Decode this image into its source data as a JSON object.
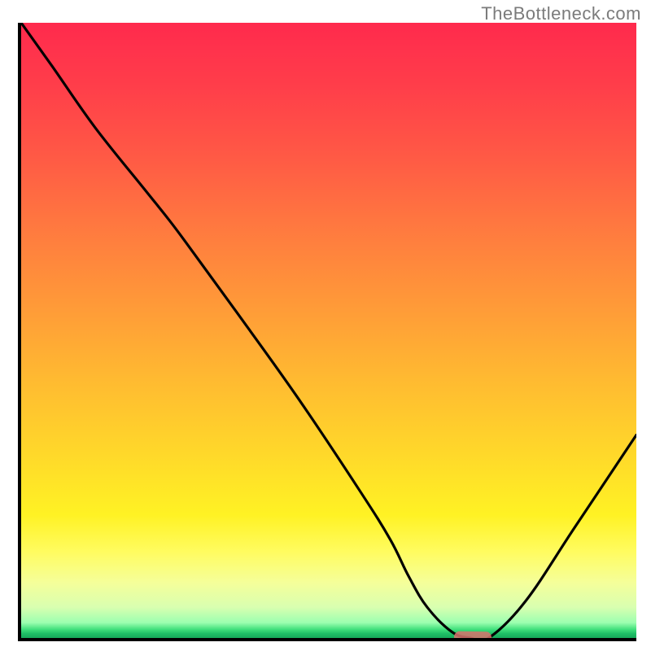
{
  "watermark": "TheBottleneck.com",
  "chart_data": {
    "type": "line",
    "title": "",
    "xlabel": "",
    "ylabel": "",
    "xlim": [
      0,
      100
    ],
    "ylim": [
      0,
      100
    ],
    "grid": false,
    "legend": false,
    "background": {
      "kind": "vertical_gradient",
      "stops": [
        {
          "pos": 0,
          "color": "#ff2a4d"
        },
        {
          "pos": 0.34,
          "color": "#ff7b3f"
        },
        {
          "pos": 0.7,
          "color": "#ffd82a"
        },
        {
          "pos": 0.9,
          "color": "#fffb80"
        },
        {
          "pos": 0.985,
          "color": "#41e07c"
        },
        {
          "pos": 1.0,
          "color": "#17a95a"
        }
      ]
    },
    "series": [
      {
        "name": "bottleneck-curve",
        "color": "#000000",
        "x": [
          0,
          5,
          12,
          20,
          24,
          27,
          35,
          45,
          55,
          60,
          63,
          66,
          70,
          73,
          76,
          82,
          90,
          100
        ],
        "y": [
          100,
          93,
          83,
          73,
          68,
          64,
          53,
          39,
          24,
          16,
          10,
          5,
          1,
          0,
          0,
          6,
          18,
          33
        ]
      }
    ],
    "annotations": [
      {
        "name": "optimal-marker",
        "shape": "rounded-bar",
        "color": "#d9736e",
        "x_range": [
          70,
          76
        ],
        "y": 0.5
      }
    ]
  }
}
